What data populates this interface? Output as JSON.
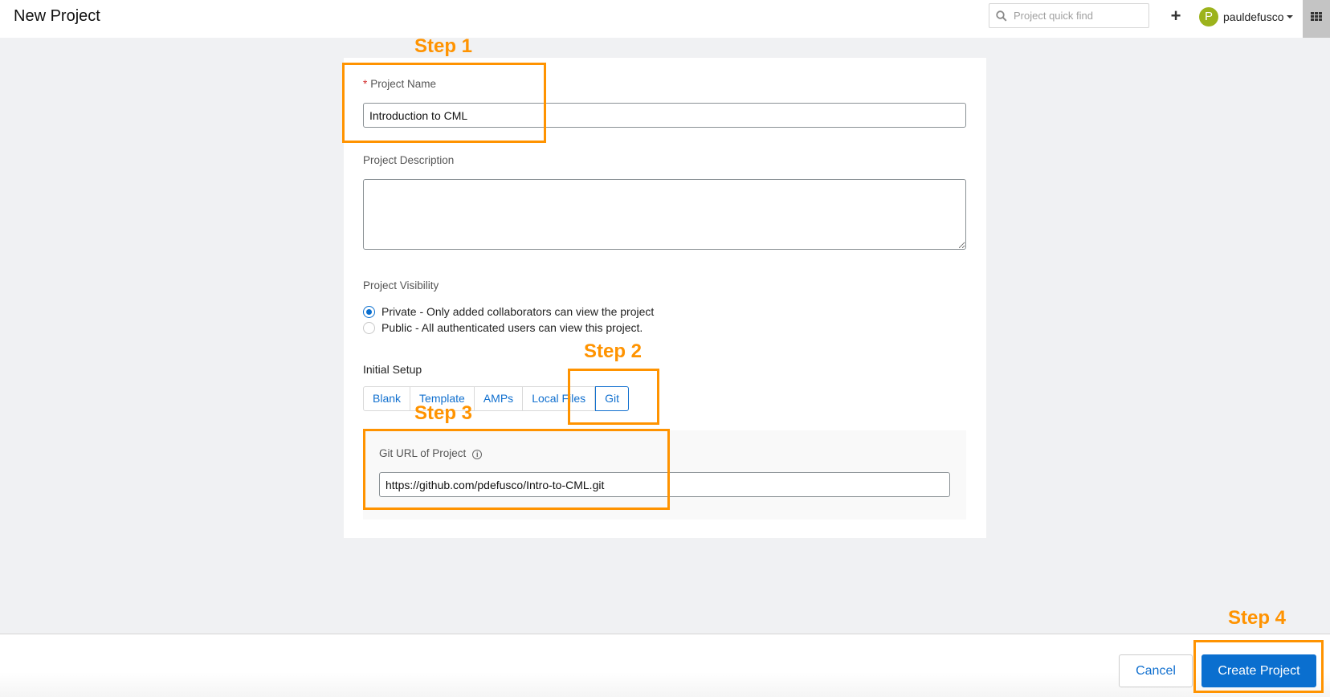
{
  "header": {
    "title": "New Project",
    "quickfind_placeholder": "Project quick find",
    "add_label": "+",
    "user": {
      "initial": "P",
      "name": "pauldefusco"
    }
  },
  "form": {
    "project_name": {
      "label": "Project Name",
      "required_marker": "*",
      "value": "Introduction to CML"
    },
    "project_description": {
      "label": "Project Description",
      "value": ""
    },
    "visibility": {
      "label": "Project Visibility",
      "options": [
        {
          "label": "Private - Only added collaborators can view the project",
          "checked": true
        },
        {
          "label": "Public - All authenticated users can view this project.",
          "checked": false
        }
      ]
    },
    "initial_setup": {
      "label": "Initial Setup",
      "tabs": [
        {
          "label": "Blank"
        },
        {
          "label": "Template"
        },
        {
          "label": "AMPs"
        },
        {
          "label": "Local Files"
        },
        {
          "label": "Git",
          "active": true
        }
      ]
    },
    "git_url": {
      "label": "Git URL of Project",
      "value": "https://github.com/pdefusco/Intro-to-CML.git"
    }
  },
  "footer": {
    "cancel_label": "Cancel",
    "create_label": "Create Project"
  },
  "annotations": {
    "color": "#ff9300",
    "steps": [
      "Step 1",
      "Step 2",
      "Step 3",
      "Step 4"
    ]
  },
  "colors": {
    "accent": "#0a6fcf",
    "avatar": "#9cb31c",
    "required": "#d32f2f"
  }
}
